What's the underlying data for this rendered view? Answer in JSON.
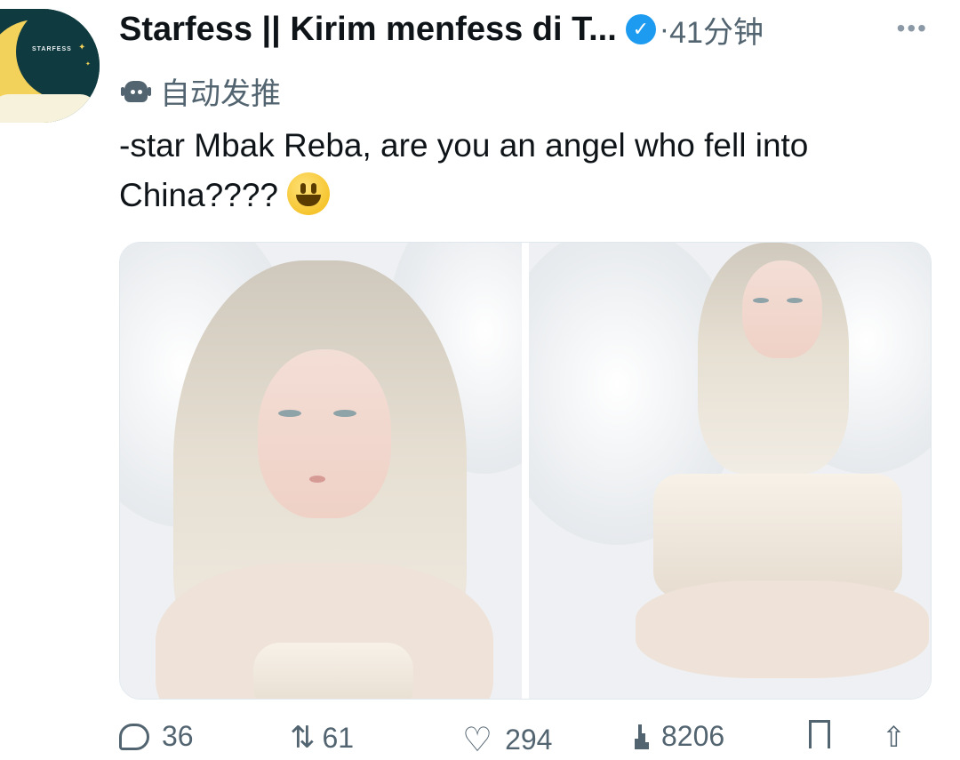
{
  "account": {
    "display_name": "Starfess || Kirim menfess di T...",
    "verified_icon": "verified-badge-icon",
    "separator": "·",
    "time": "41分钟",
    "more_icon": "more-options-icon",
    "avatar_brand": "STARFESS"
  },
  "automated": {
    "icon": "bot-icon",
    "label": "自动发推"
  },
  "tweet": {
    "text": "-star Mbak Reba, are you an angel who fell into China????",
    "emoji": "smiley-emoji"
  },
  "media": {
    "count": 2,
    "photos": [
      {
        "name": "photo-angel-portrait"
      },
      {
        "name": "photo-angel-kneeling"
      }
    ]
  },
  "actions": {
    "reply_count": "36",
    "retweet_count": "61",
    "like_count": "294",
    "views_count": "8206"
  },
  "colors": {
    "text_primary": "#0f1419",
    "text_secondary": "#536471",
    "verified": "#1d9bf0"
  }
}
